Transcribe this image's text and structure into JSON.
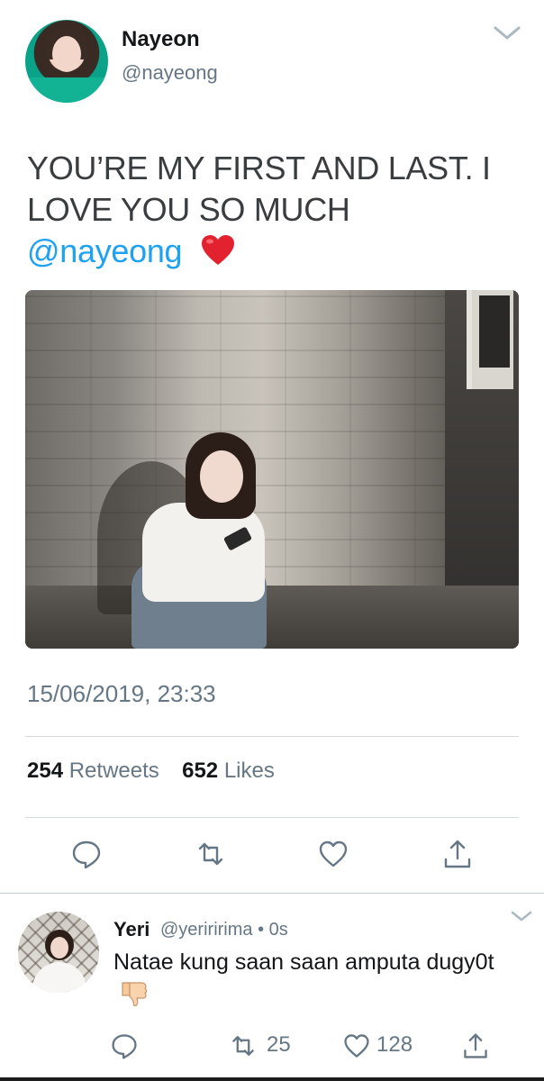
{
  "tweet": {
    "author_name": "Nayeon",
    "author_handle": "@nayeong",
    "text": "YOU’RE MY FIRST AND LAST. I LOVE YOU SO MUCH",
    "mention": "@nayeong",
    "emoji": "red-heart",
    "timestamp": "15/06/2019, 23:33",
    "retweets_count": "254",
    "retweets_label": "Retweets",
    "likes_count": "652",
    "likes_label": "Likes"
  },
  "reply": {
    "author_name": "Yeri",
    "author_handle": "@yeriririma",
    "separator": "•",
    "time": "0s",
    "text": "Natae kung saan saan amputa dugy0t",
    "emoji": "thumbs-down",
    "retweets_count": "25",
    "likes_count": "128"
  },
  "icons": {
    "reply": "speech-bubble-icon",
    "retweet": "retweet-icon",
    "like": "heart-icon",
    "share": "share-icon",
    "more": "chevron-down-icon"
  },
  "colors": {
    "link": "#1da1f2",
    "secondary_text": "#657786",
    "primary_text": "#14171a",
    "divider": "#d3dbe1"
  }
}
